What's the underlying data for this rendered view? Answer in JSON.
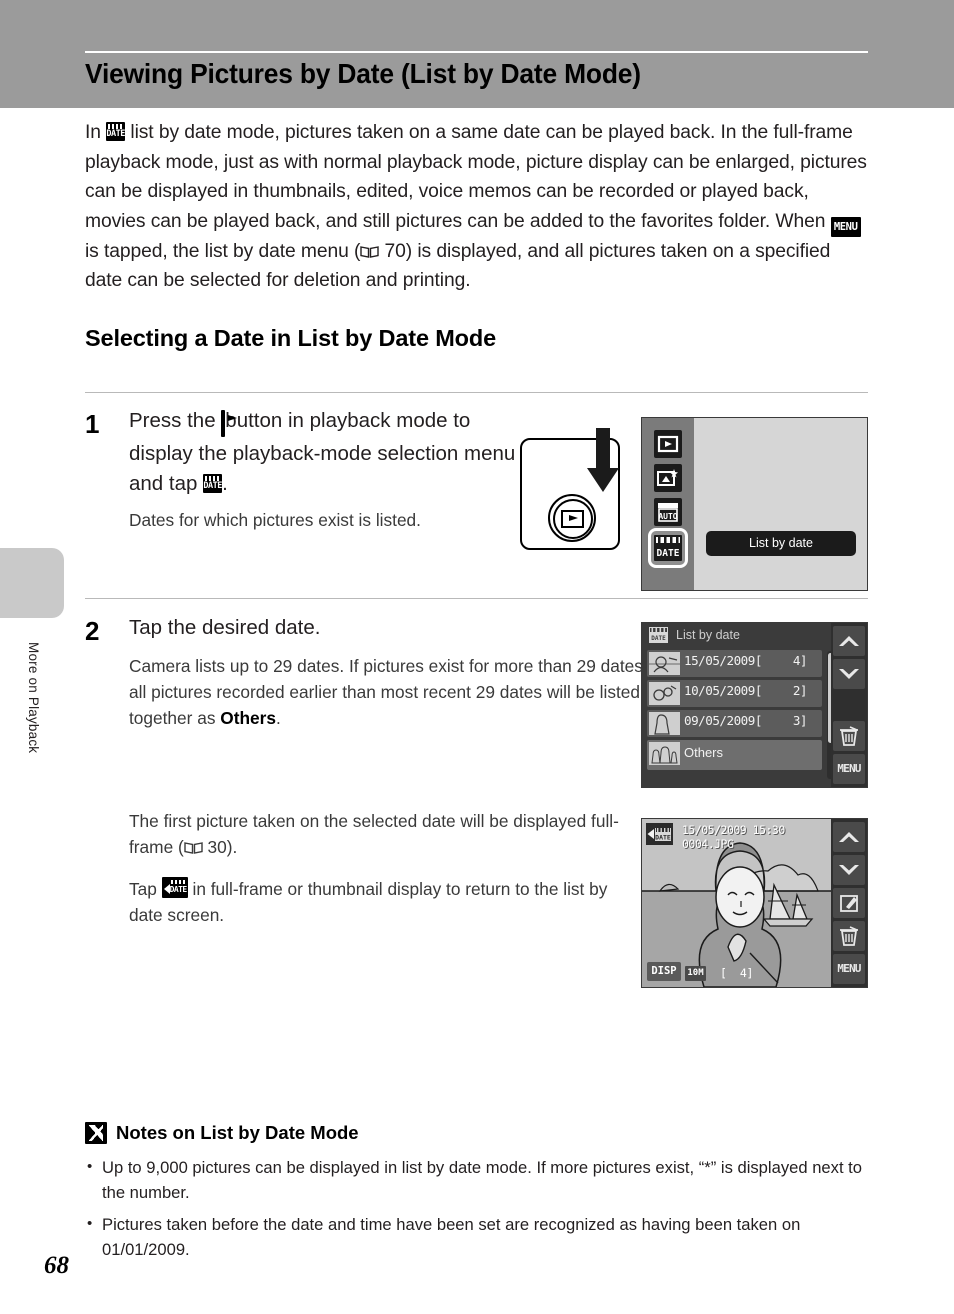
{
  "header": {
    "title": "Viewing Pictures by Date (List by Date Mode)"
  },
  "sidebar": {
    "chapter_label": "More on Playback",
    "page_number": "68"
  },
  "intro": {
    "part1": "In ",
    "part2": " list by date mode, pictures taken on a same date can be played back. In the full-frame playback mode, just as with normal playback mode, picture display can be enlarged, pictures can be displayed in thumbnails, edited, voice memos can be recorded or played back, movies can be played back, and still pictures can be added to the favorites folder. When ",
    "part3": " is tapped, the list by date menu (",
    "page_ref": " 70",
    "part4": ") is displayed, and all pictures taken on a specified date can be selected for deletion and printing."
  },
  "section": {
    "heading": "Selecting a Date in List by Date Mode"
  },
  "steps": [
    {
      "number": "1",
      "title_a": "Press the ",
      "title_b": " button in playback mode to display the playback-mode selection menu and tap ",
      "title_c": ".",
      "sub": "Dates for which pictures exist is listed."
    },
    {
      "number": "2",
      "title": "Tap the desired date.",
      "sub_a": "Camera lists up to 29 dates. If pictures exist for more than 29 dates, all pictures recorded earlier than most recent 29 dates will be listed together as ",
      "sub_a_bold": "Others",
      "sub_a_end": ".",
      "sub_b1": "The first picture taken on the selected date will be displayed full-frame (",
      "sub_b_ref": " 30",
      "sub_b2": ").",
      "sub_c1": "Tap ",
      "sub_c2": " in full-frame or thumbnail display to return to the list by date screen."
    }
  ],
  "cam1": {
    "icons": [
      "play-icon",
      "favorites-icon",
      "auto-sort-icon",
      "list-by-date-icon"
    ],
    "icon_labels": [
      "",
      "",
      "AUTO",
      "DATE"
    ],
    "selected_index": 3,
    "tooltip": "List by date"
  },
  "cam2": {
    "header": "List by date",
    "rows": [
      {
        "date": "15/05/2009",
        "bracket_open": "[",
        "count": "4",
        "bracket_close": "]"
      },
      {
        "date": "10/05/2009",
        "bracket_open": "[",
        "count": "2",
        "bracket_close": "]"
      },
      {
        "date": "09/05/2009",
        "bracket_open": "[",
        "count": "3",
        "bracket_close": "]"
      },
      {
        "date": "Others",
        "bracket_open": "",
        "count": "",
        "bracket_close": ""
      }
    ],
    "side_buttons": [
      "up-chevron",
      "down-chevron",
      "delete",
      "menu"
    ],
    "side_labels": [
      "∧",
      "∨",
      "♻",
      "MENU"
    ]
  },
  "cam3": {
    "back_icon_label": "DATE",
    "osd_line1": "15/05/2009 15:30",
    "osd_line2": "0004.JPG",
    "disp_label": "DISP",
    "size_label": "10M",
    "frame_counter": "[  4]",
    "side_buttons": [
      "up-chevron",
      "down-chevron",
      "edit",
      "delete",
      "menu"
    ],
    "side_labels": [
      "∧",
      "∨",
      "✎",
      "♻",
      "MENU"
    ]
  },
  "notes": {
    "heading": "Notes on List by Date Mode",
    "items": [
      "Up to 9,000 pictures can be displayed in list by date mode. If more pictures exist, “*” is displayed next to the number.",
      "Pictures taken before the date and time have been set are recognized as having been taken on 01/01/2009."
    ]
  },
  "colors": {
    "header_band": "#9b9b9b",
    "sidebar_tab": "#c9c9c9",
    "text": "#231f20",
    "rule": "#b9b9b9"
  }
}
